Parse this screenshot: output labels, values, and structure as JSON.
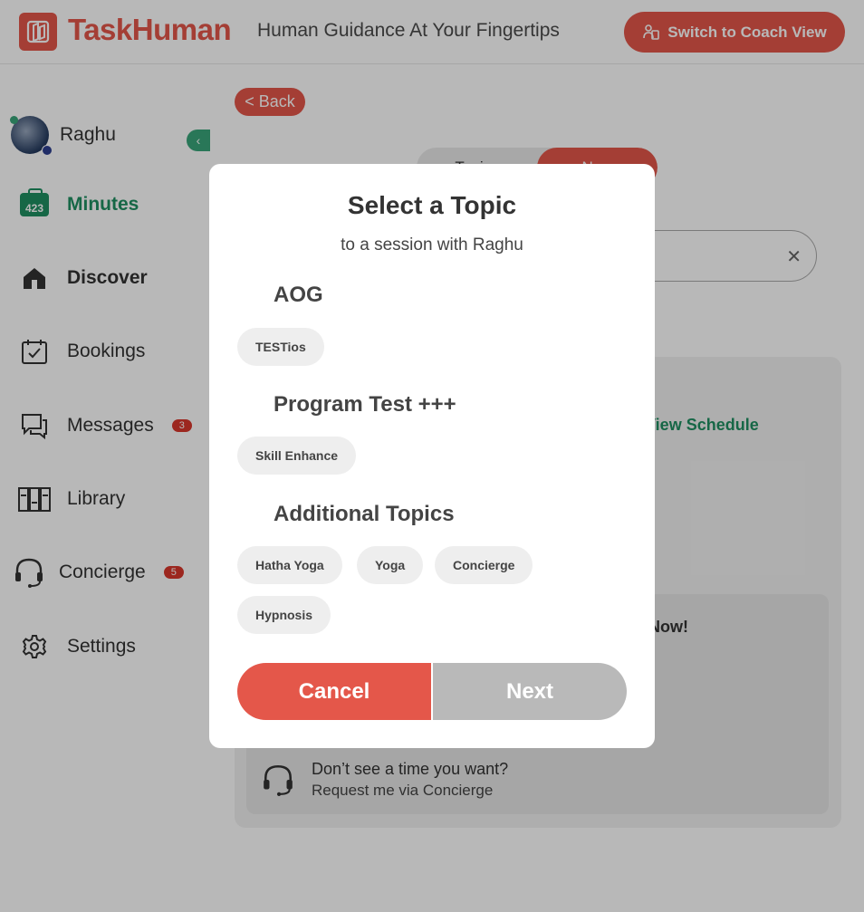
{
  "header": {
    "logo_text": "TaskHuman",
    "tagline": "Human Guidance At Your Fingertips",
    "coach_button": "Switch to Coach View"
  },
  "sidebar": {
    "user_name": "Raghu",
    "minutes_count": "423",
    "items": [
      {
        "label": "Minutes",
        "icon": "minutes-icon"
      },
      {
        "label": "Discover",
        "icon": "home-icon"
      },
      {
        "label": "Bookings",
        "icon": "calendar-check-icon"
      },
      {
        "label": "Messages",
        "icon": "chat-icon",
        "count": "3"
      },
      {
        "label": "Library",
        "icon": "library-icon"
      },
      {
        "label": "Concierge",
        "icon": "headset-icon",
        "count": "5"
      },
      {
        "label": "Settings",
        "icon": "gear-icon"
      }
    ]
  },
  "main": {
    "back_label": "< Back",
    "toggle_left": "Topics",
    "toggle_right": "Now",
    "view_schedule": "View Schedule",
    "now_text": "Now!",
    "concierge_title": "Don’t see a time you want?",
    "concierge_sub": "Request me via Concierge"
  },
  "modal": {
    "title": "Select a Topic",
    "subtitle": "to a session with Raghu",
    "groups": [
      {
        "title": "AOG",
        "topics": [
          "TESTios"
        ]
      },
      {
        "title": "Program Test +++",
        "topics": [
          "Skill Enhance"
        ]
      },
      {
        "title": "Additional Topics",
        "topics": [
          "Hatha Yoga",
          "Yoga",
          "Concierge",
          "Hypnosis"
        ]
      }
    ],
    "cancel_label": "Cancel",
    "next_label": "Next"
  },
  "colors": {
    "brand": "#e4574a",
    "accent_green": "#1f8f62",
    "disabled": "#b9b9b9"
  }
}
